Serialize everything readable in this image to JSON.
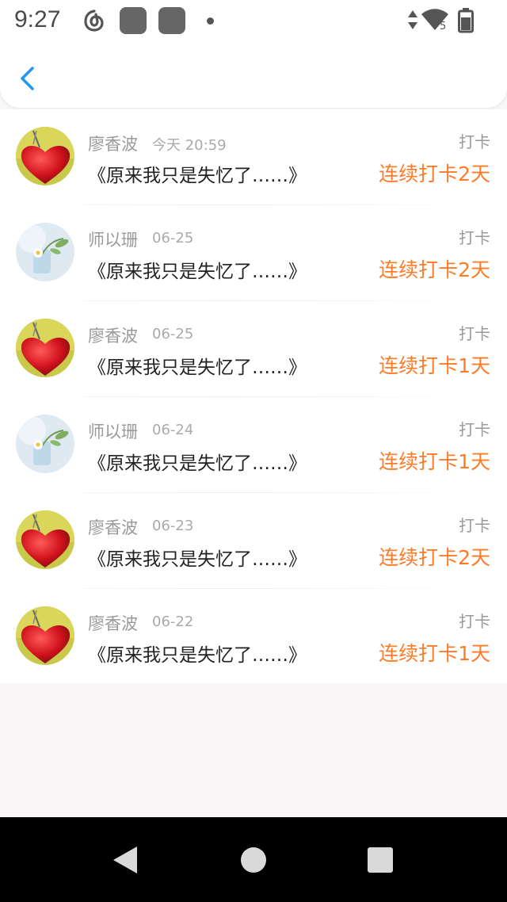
{
  "status_bar": {
    "time": "9:27",
    "icons": [
      "netease-music-icon",
      "app-icon",
      "app-icon",
      "notification-dot-icon",
      "data-arrows-icon",
      "wifi-icon",
      "battery-icon"
    ],
    "wifi_badge": "5"
  },
  "header": {
    "back_icon": "chevron-left-icon",
    "accent": "#2196f3"
  },
  "colors": {
    "streak": "#ff7b28",
    "meta": "#999999"
  },
  "items": [
    {
      "name": "廖香波",
      "date": "今天 20:59",
      "title": "《原来我只是失忆了……》",
      "tag": "打卡",
      "streak": "连续打卡2天",
      "avatar": "red-heart"
    },
    {
      "name": "师以珊",
      "date": "06-25",
      "title": "《原来我只是失忆了……》",
      "tag": "打卡",
      "streak": "连续打卡2天",
      "avatar": "flower-vase"
    },
    {
      "name": "廖香波",
      "date": "06-25",
      "title": "《原来我只是失忆了……》",
      "tag": "打卡",
      "streak": "连续打卡1天",
      "avatar": "red-heart"
    },
    {
      "name": "师以珊",
      "date": "06-24",
      "title": "《原来我只是失忆了……》",
      "tag": "打卡",
      "streak": "连续打卡1天",
      "avatar": "flower-vase"
    },
    {
      "name": "廖香波",
      "date": "06-23",
      "title": "《原来我只是失忆了……》",
      "tag": "打卡",
      "streak": "连续打卡2天",
      "avatar": "red-heart"
    },
    {
      "name": "廖香波",
      "date": "06-22",
      "title": "《原来我只是失忆了……》",
      "tag": "打卡",
      "streak": "连续打卡1天",
      "avatar": "red-heart"
    }
  ],
  "nav_bar": {
    "back": "triangle-back-icon",
    "home": "circle-home-icon",
    "recents": "square-recents-icon"
  }
}
